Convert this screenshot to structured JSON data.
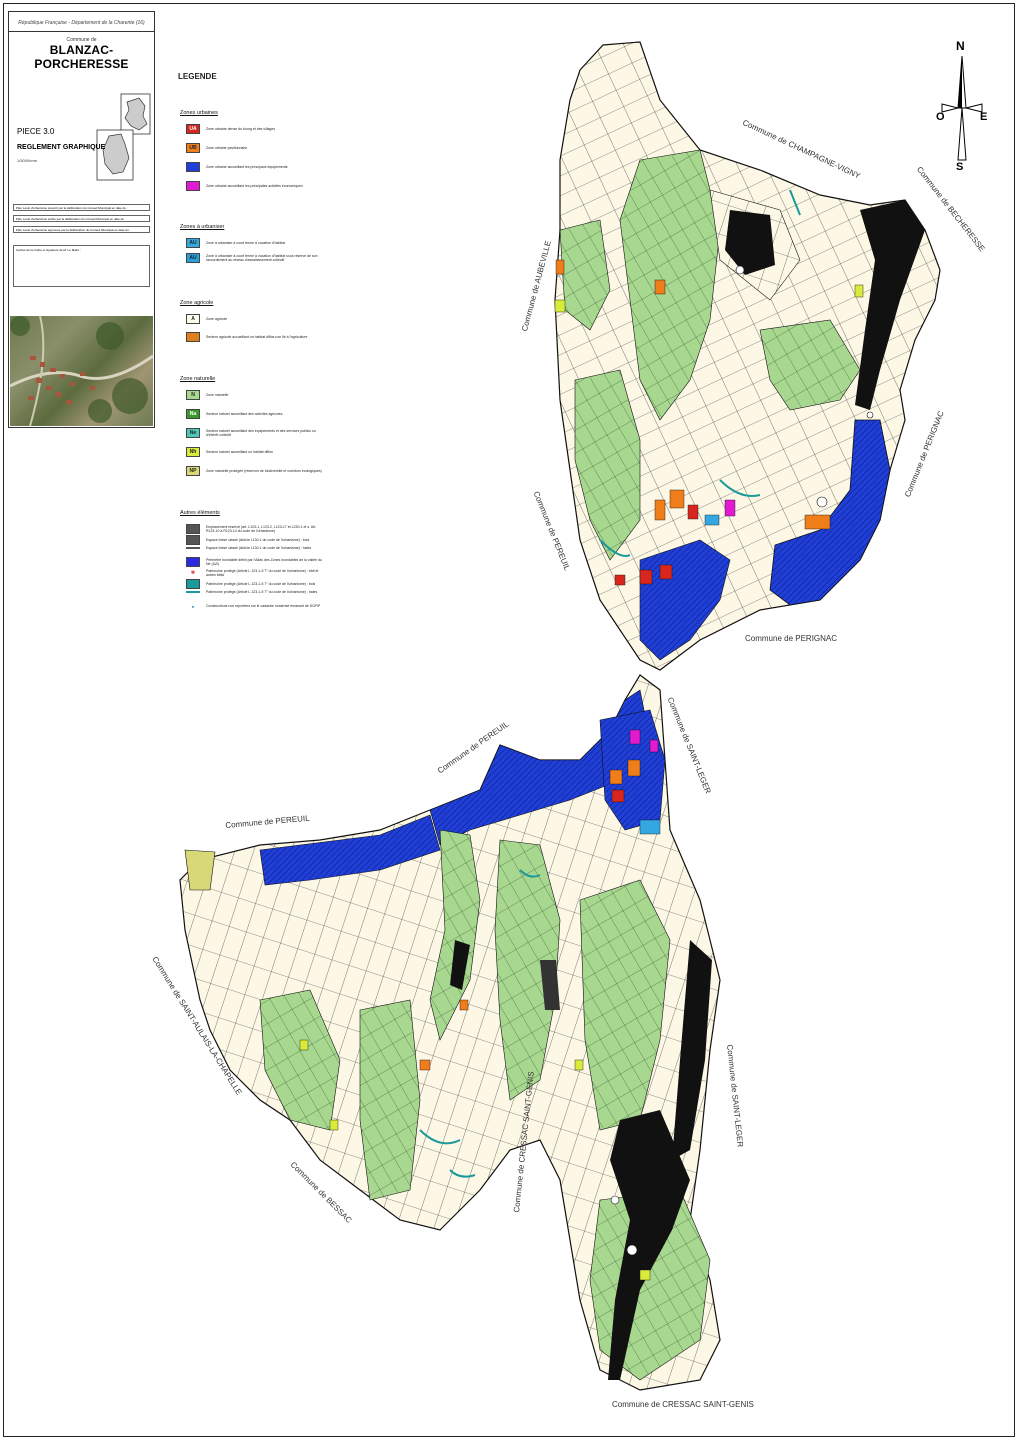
{
  "header": {
    "republique": "République Française - Département de la Charente (16)",
    "commune_de": "Commune de",
    "commune_name": "BLANZAC-PORCHERESSE",
    "piece": "PIECE 3.0",
    "reglement": "REGLEMENT GRAPHIQUE",
    "echelle": "1/5000ème",
    "approvals": [
      "Plan Local d'urbanisme prescrit par la délibération du Conseil Municipal en date du :",
      "Plan Local d'urbanisme arrêté par la délibération du Conseil Municipal en date du :",
      "Plan Local d'urbanisme approuvé par la délibération du Conseil Municipal en date du :"
    ],
    "signature": "Cachet de la mairie et signature de M. Le Maire :"
  },
  "legend": {
    "title": "LEGENDE",
    "sections": [
      {
        "title": "Zones urbaines",
        "items": [
          {
            "code": "UA",
            "color": "#d7261e",
            "label": "Zone urbaine dense du bourg et des villages"
          },
          {
            "code": "UB",
            "color": "#ef7d1a",
            "label": "Zone urbaine pavillonnaire"
          },
          {
            "code": "",
            "color": "#1f3fd6",
            "label": "Zone urbaine accueillant les principaux équipements"
          },
          {
            "code": "",
            "color": "#e21ad1",
            "label": "Zone urbaine accueillant les principales activités économiques"
          }
        ]
      },
      {
        "title": "Zones à urbaniser",
        "items": [
          {
            "code": "AU",
            "color": "#33a8e0",
            "label": "Zone à urbaniser à court terme à vocation d'habitat"
          },
          {
            "code": "AU",
            "color": "#2aa0d8",
            "label": "Zone à urbaniser à court terme à vocation d'habitat sous réserve de son raccordement au réseau d'assainissement collectif"
          }
        ]
      },
      {
        "title": "Zone agricole",
        "items": [
          {
            "code": "A",
            "color": "#fdf9ec",
            "label": "Zone agricole"
          },
          {
            "code": "",
            "color": "#e0801c",
            "label": "Secteur agricole accueillant un habitat diffus non lié à l'agriculture"
          }
        ]
      },
      {
        "title": "Zone naturelle",
        "items": [
          {
            "code": "N",
            "color": "#a8d890",
            "label": "Zone naturelle"
          },
          {
            "code": "Na",
            "color": "#3a9a2c",
            "label": "Secteur naturel accueillant des activités agricoles"
          },
          {
            "code": "Ne",
            "color": "#4fc7b5",
            "label": "Secteur naturel accueillant des équipements et des services publics ou d'intérêt collectif"
          },
          {
            "code": "Nh",
            "color": "#d8ea3a",
            "label": "Secteur naturel accueillant un habitat diffus"
          },
          {
            "code": "NP",
            "color": "#d8d878",
            "label": "Zone naturelle protégée (réservoir de biodiversité et corridors écologiques)"
          }
        ]
      },
      {
        "title": "Autres éléments",
        "items": [
          {
            "code": "",
            "color": "#555555",
            "label": "Emplacement réservé (art. L123-1, L123-2, L123-17 et L230-1 et s. Art. R123-10 à R123-14 du code de l'urbanisme)"
          },
          {
            "code": "",
            "color": "#555555",
            "label": "Espace boisé classé (Article L130-1 du code de l'urbanisme) : bois"
          },
          {
            "code": "",
            "color": "#555555",
            "label": "Espace boisé classé (Article L130-1 du code de l'urbanisme) : haies",
            "line": true
          },
          {
            "code": "",
            "color": "#2a2ae0",
            "label": "Périmètre inondable défini par l'Atlas des Zones Inondables de la vallée du Né (AZI)"
          },
          {
            "code": "",
            "color": "#e05050",
            "label": "Patrimoine protégé (Article L.123-1-5 7° du code de l'urbanisme) : bâti et autres bâtis",
            "star": true
          },
          {
            "code": "",
            "color": "#1a9a9a",
            "label": "Patrimoine protégé (Article L.123-1-5 7° du code de l'urbanisme) : bois"
          },
          {
            "code": "",
            "color": "#1a9a9a",
            "label": "Patrimoine protégé (Article L.123-1-5 7° du code de l'urbanisme) : haies",
            "line": true
          },
          {
            "code": "",
            "color": "#1a6aa0",
            "label": "Constructions non reportées sur le cadastre numérisé émanant de DGFIP",
            "dot": true
          }
        ]
      }
    ]
  },
  "compass": {
    "n": "N",
    "s": "S",
    "e": "E",
    "o": "O"
  },
  "neighbours": {
    "champagne": "Commune de CHAMPAGNE-VIGNY",
    "bechresse": "Commune de BECHERESSE",
    "aubeville": "Commune de AUBEVILLE",
    "perignac_e": "Commune de PERIGNAC",
    "pereuil_c": "Commune de PEREUIL",
    "perignac_s": "Commune de PERIGNAC",
    "pereuil_n": "Commune de PEREUIL",
    "pereuil_w": "Commune de PEREUIL",
    "saint_leger_n": "Commune de SAINT-LEGER",
    "saint_aulais": "Commune de SAINT-AULAIS-LA-CHAPELLE",
    "bessac": "Commune de BESSAC",
    "cressac_mid": "Commune de CRESSAC SAINT-GENIS",
    "saint_leger_s": "Commune de SAINT-LEGER",
    "cressac_bottom": "Commune de CRESSAC SAINT-GENIS"
  }
}
